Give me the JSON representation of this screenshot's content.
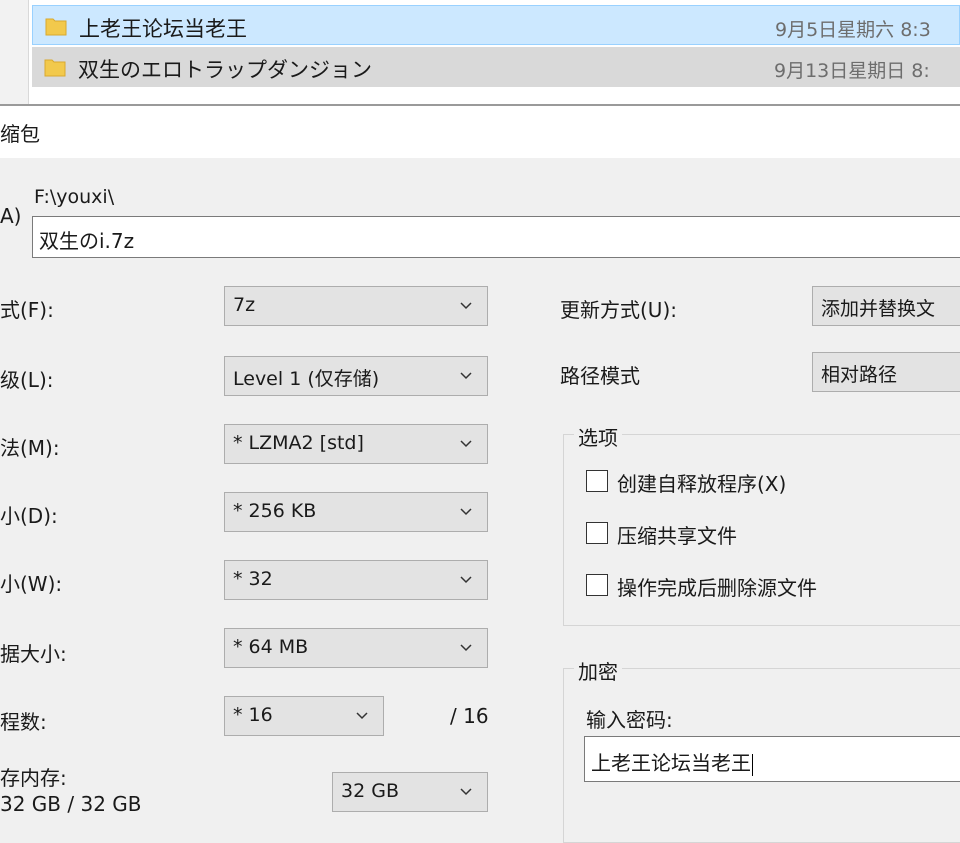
{
  "explorer": {
    "files": [
      {
        "name": "上老王论坛当老王",
        "date": "9月5日星期六 8:3",
        "icon": "folder-icon"
      },
      {
        "name": "双生のエロトラップダンジョン",
        "date": "9月13日星期日 8:",
        "icon": "folder-icon"
      }
    ]
  },
  "dialog": {
    "title": "缩包",
    "archive": {
      "label_fragment": "A)",
      "path": "F:\\youxi\\",
      "filename": "双生のi.7z"
    },
    "left_options": [
      {
        "label": "式(F):",
        "value": "7z"
      },
      {
        "label": "级(L):",
        "value": "Level 1 (仅存储)"
      },
      {
        "label": "法(M):",
        "value": "*  LZMA2 [std]"
      },
      {
        "label": "小(D):",
        "value": "*  256 KB"
      },
      {
        "label": "小(W):",
        "value": "*  32"
      },
      {
        "label": "据大小:",
        "value": "*  64 MB"
      }
    ],
    "threads": {
      "label": "程数:",
      "value": "*  16",
      "max": "/ 16"
    },
    "memory": {
      "label": "存内存:",
      "usage": "32 GB / 32 GB",
      "value": "32 GB"
    },
    "update_mode": {
      "label": "更新方式(U):",
      "value": "添加并替换文"
    },
    "path_mode": {
      "label": "路径模式",
      "value": "相对路径"
    },
    "options_group": {
      "title": "选项",
      "checkboxes": [
        {
          "label": "创建自释放程序(X)",
          "checked": false
        },
        {
          "label": "压缩共享文件",
          "checked": false
        },
        {
          "label": "操作完成后删除源文件",
          "checked": false
        }
      ]
    },
    "encryption_group": {
      "title": "加密",
      "password_label": "输入密码:",
      "password_value": "上老王论坛当老王"
    }
  },
  "colors": {
    "selection_bg": "#cce8ff",
    "selection_border": "#99d1ff",
    "dialog_bg": "#f0f0f0",
    "folder": "#f2c94c"
  }
}
